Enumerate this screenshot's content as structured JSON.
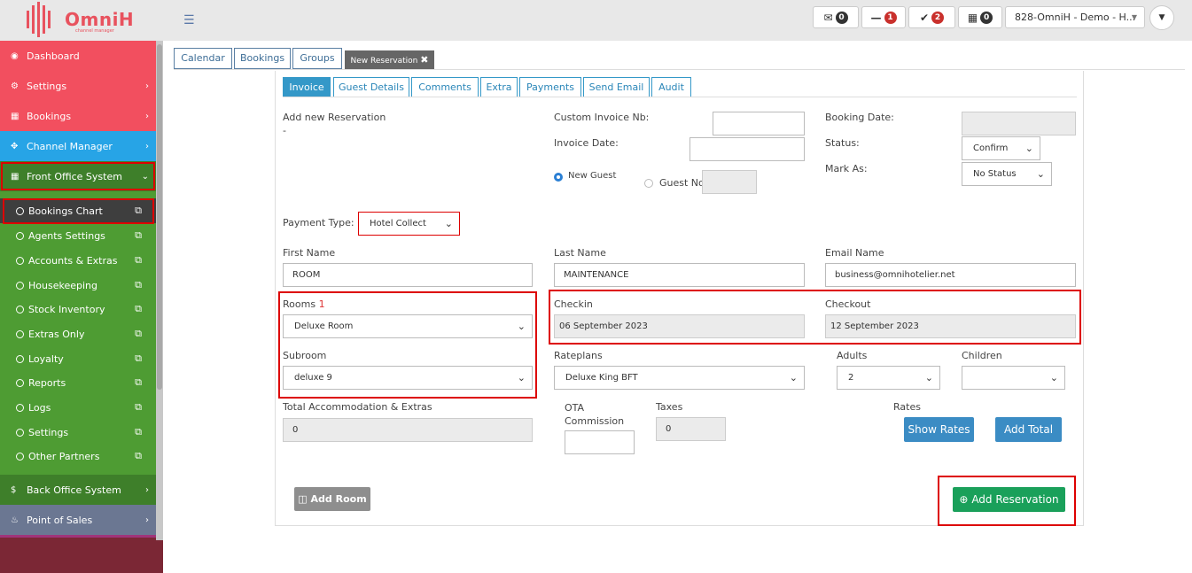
{
  "brand": {
    "name": "OmniH",
    "tagline": "channel manager"
  },
  "topbar": {
    "mail_count": "0",
    "minus_count": "1",
    "check_count": "2",
    "calendar_count": "0",
    "hotel": "828-OmniH - Demo - H..."
  },
  "sidebar": {
    "dashboard": "Dashboard",
    "settings": "Settings",
    "bookings": "Bookings",
    "channel_manager": "Channel Manager",
    "front_office": "Front Office System",
    "sub": [
      "Bookings Chart",
      "Agents Settings",
      "Accounts & Extras",
      "Housekeeping",
      "Stock Inventory",
      "Extras Only",
      "Loyalty",
      "Reports",
      "Logs",
      "Settings",
      "Other Partners"
    ],
    "back_office": "Back Office System",
    "pos": "Point of Sales"
  },
  "top_tabs": [
    "Calendar",
    "Bookings",
    "Groups",
    "New Reservation"
  ],
  "inner_tabs": [
    "Invoice",
    "Guest Details",
    "Comments",
    "Extra",
    "Payments",
    "Send Email",
    "Audit"
  ],
  "form": {
    "add_new_label": "Add new Reservation",
    "add_new_value": "-",
    "custom_invoice_label": "Custom Invoice Nb:",
    "invoice_date_label": "Invoice Date:",
    "booking_date_label": "Booking Date:",
    "status_label": "Status:",
    "status_value": "Confirm",
    "mark_as_label": "Mark As:",
    "mark_as_value": "No Status",
    "new_guest_label": "New Guest",
    "guest_no_label": "Guest No",
    "payment_type_label": "Payment Type:",
    "payment_type_value": "Hotel Collect",
    "first_name_label": "First Name",
    "first_name_value": "ROOM",
    "last_name_label": "Last Name",
    "last_name_value": "MAINTENANCE",
    "email_label": "Email Name",
    "email_value": "business@omnihotelier.net",
    "rooms_label": "Rooms",
    "rooms_num": "1",
    "rooms_value": "Deluxe Room",
    "checkin_label": "Checkin",
    "checkin_value": "06 September 2023",
    "checkout_label": "Checkout",
    "checkout_value": "12 September 2023",
    "subroom_label": "Subroom",
    "subroom_value": "deluxe 9",
    "rateplans_label": "Rateplans",
    "rateplans_value": "Deluxe King BFT",
    "adults_label": "Adults",
    "adults_value": "2",
    "children_label": "Children",
    "children_value": "",
    "total_label": "Total Accommodation & Extras",
    "total_value": "0",
    "ota_label": "OTA Commission",
    "taxes_label": "Taxes",
    "taxes_value": "0",
    "rates_label": "Rates",
    "show_rates": "Show Rates",
    "add_total": "Add Total",
    "add_room": "Add Room",
    "add_reservation": "Add Reservation"
  },
  "colors": {
    "sidebar_red": "#f24f5f",
    "sidebar_blue": "#27a4e6",
    "sidebar_green_dark": "#3e7f2a",
    "sidebar_green": "#4e9c33",
    "sidebar_gray": "#6b7792",
    "accent_blue": "#3498c8",
    "success_green": "#1aa05a"
  }
}
